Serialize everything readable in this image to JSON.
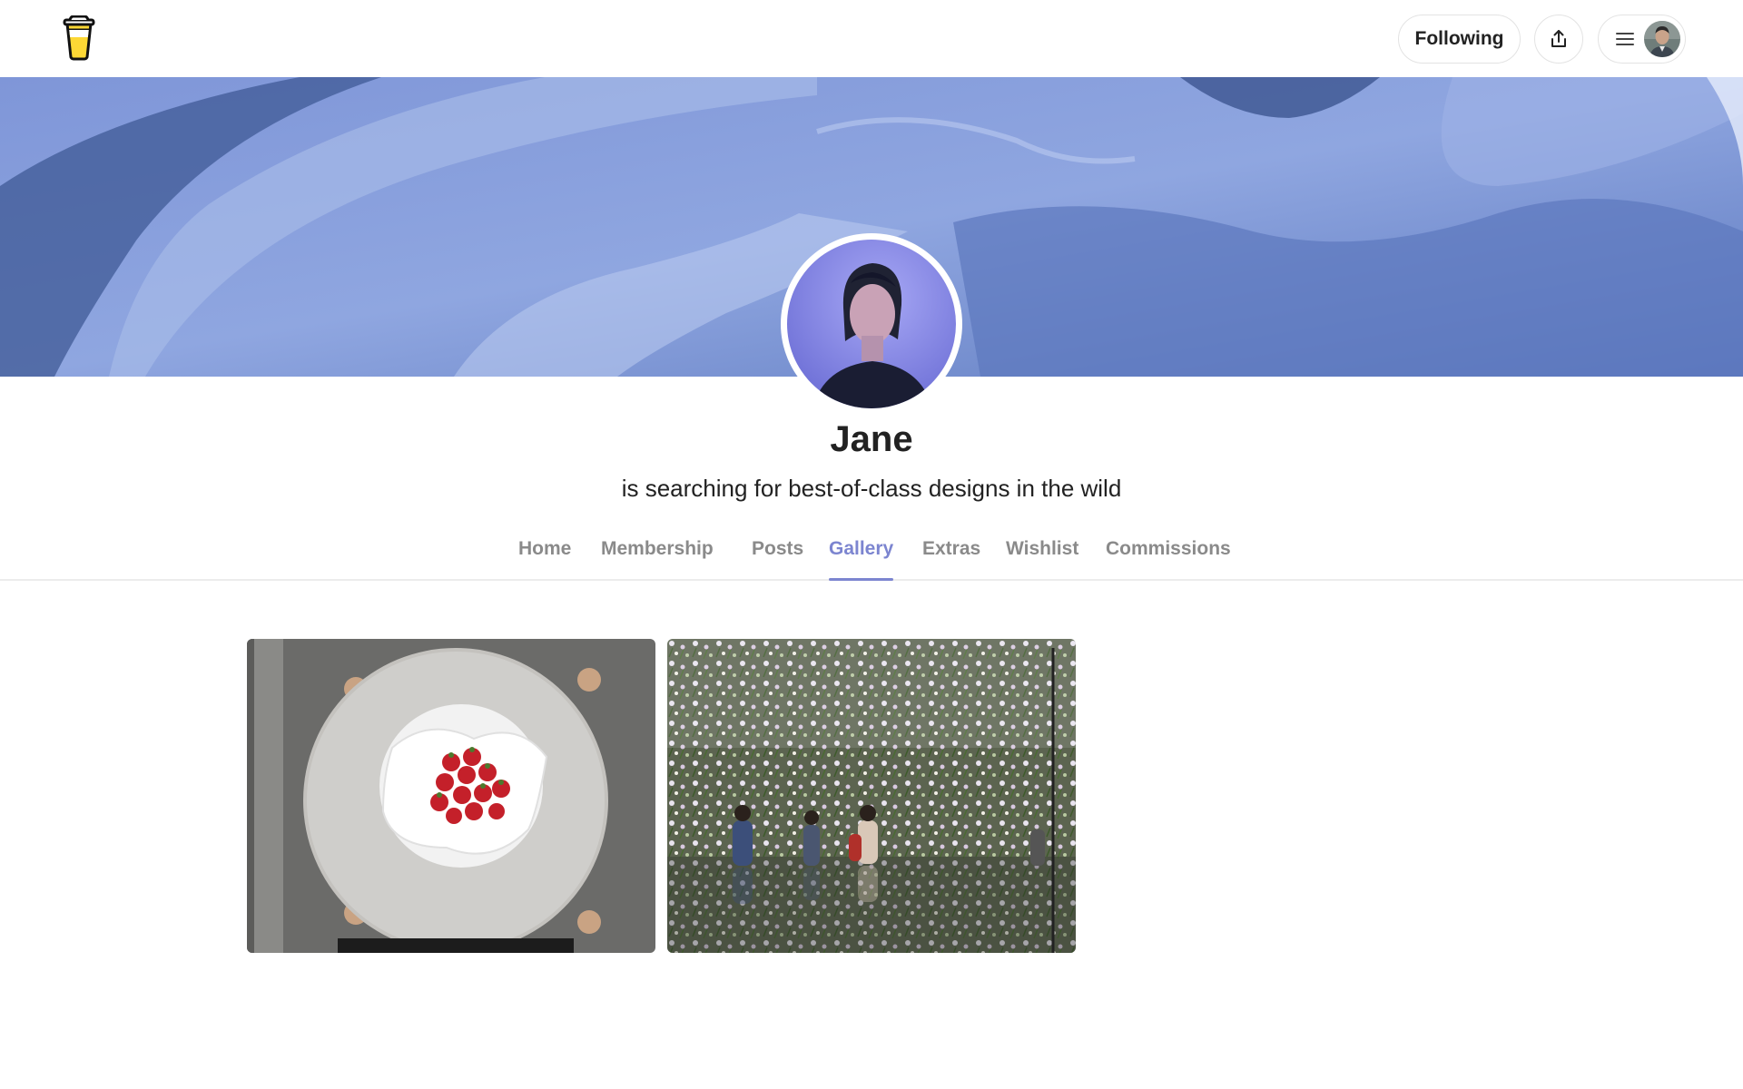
{
  "header": {
    "logo_icon": "coffee-cup-logo",
    "following_label": "Following",
    "share_icon": "share-icon",
    "menu_icon": "hamburger-menu-icon"
  },
  "profile": {
    "name": "Jane",
    "tagline": "is searching for best-of-class designs in the wild"
  },
  "tabs": [
    {
      "label": "Home",
      "active": false
    },
    {
      "label": "Membership",
      "active": false
    },
    {
      "label": "Posts",
      "active": false
    },
    {
      "label": "Gallery",
      "active": true
    },
    {
      "label": "Extras",
      "active": false
    },
    {
      "label": "Wishlist",
      "active": false
    },
    {
      "label": "Commissions",
      "active": false
    }
  ],
  "gallery": {
    "items": [
      {
        "subject": "strawberries-on-plate-photo"
      },
      {
        "subject": "hanging-flower-garden-photo"
      }
    ]
  },
  "colors": {
    "accent": "#7c85d0",
    "logo_yellow": "#fdd835",
    "cover_blue": "#6e86c8"
  }
}
